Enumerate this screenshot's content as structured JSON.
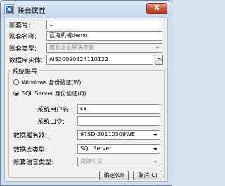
{
  "window": {
    "title": "账套属性",
    "close_label": "X"
  },
  "form": {
    "account_no": {
      "label": "账套号:",
      "value": "1"
    },
    "account_name": {
      "label": "账套名称:",
      "value": "蓝海机械demo"
    },
    "account_type": {
      "label": "账套类型:",
      "value": "成长企业解决方案"
    },
    "db_instance": {
      "label": "数据库实体:",
      "value": "AIS20090324110122",
      "browse_label": ">"
    }
  },
  "system_account": {
    "group_label": "系统帐号",
    "windows_auth_label": "Windows 身份验证(W)",
    "sql_auth_label": "SQL Server 身份验证(Q)",
    "selected": "sql",
    "username_label": "系统用户名:",
    "username_value": "sa",
    "password_label": "系统口令:",
    "password_value": "",
    "db_server_label": "数据服务器:",
    "db_server_value": "97SD-20110309WE",
    "db_type_label": "数据库类型:",
    "db_type_value": "SQL Server",
    "lang_type_label": "账套语言类型:",
    "lang_type_value": "简体中文"
  },
  "buttons": {
    "ok_label": "确定(O)",
    "cancel_label": "取消(C)"
  },
  "icons": {
    "window_icon": "app-icon",
    "dropdown": "chevron-down-icon"
  }
}
